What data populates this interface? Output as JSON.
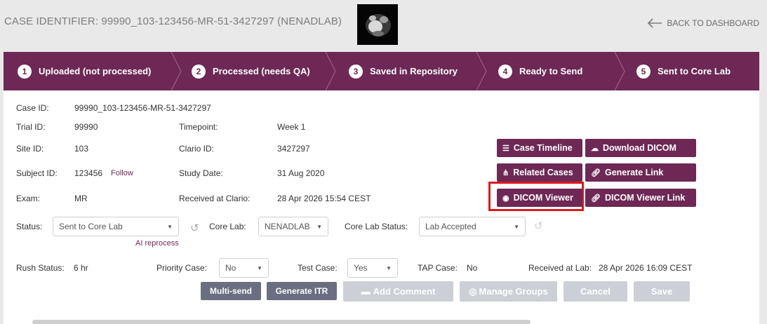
{
  "header": {
    "case_identifier": "CASE IDENTIFIER: 99990_103-123456-MR-51-3427297 (NENADLAB)",
    "back_label": "BACK TO DASHBOARD"
  },
  "steps": [
    {
      "num": "1",
      "label": "Uploaded (not processed)"
    },
    {
      "num": "2",
      "label": "Processed (needs QA)"
    },
    {
      "num": "3",
      "label": "Saved in Repository"
    },
    {
      "num": "4",
      "label": "Ready to Send"
    },
    {
      "num": "5",
      "label": "Sent to Core Lab"
    }
  ],
  "details": {
    "case_id_label": "Case ID:",
    "case_id": "99990_103-123456-MR-51-3427297",
    "trial_id_label": "Trial ID:",
    "trial_id": "99990",
    "timepoint_label": "Timepoint:",
    "timepoint": "Week 1",
    "site_id_label": "Site ID:",
    "site_id": "103",
    "clario_id_label": "Clario ID:",
    "clario_id": "3427297",
    "subject_id_label": "Subject ID:",
    "subject_id": "123456",
    "follow": "Follow",
    "study_date_label": "Study Date:",
    "study_date": "31 Aug 2020",
    "exam_label": "Exam:",
    "exam": "MR",
    "received_label": "Received at Clario:",
    "received": "28 Apr 2026 15:54 CEST"
  },
  "actions": {
    "case_timeline": "Case Timeline",
    "download_dicom": "Download DICOM",
    "related_cases": "Related Cases",
    "generate_link": "Generate Link",
    "dicom_viewer": "DICOM Viewer",
    "dicom_viewer_link": "DICOM Viewer Link"
  },
  "status_row": {
    "status_label": "Status:",
    "status_value": "Sent to Core Lab",
    "ai_reprocess": "AI reprocess",
    "core_lab_label": "Core Lab:",
    "core_lab_value": "NENADLAB",
    "core_lab_status_label": "Core Lab Status:",
    "core_lab_status_value": "Lab Accepted"
  },
  "rush_row": {
    "rush_label": "Rush Status:",
    "rush_value": "6 hr",
    "priority_label": "Priority Case:",
    "priority_value": "No",
    "test_label": "Test Case:",
    "test_value": "Yes",
    "tap_label": "TAP Case:",
    "tap_value": "No",
    "received_lab_label": "Received at Lab:",
    "received_lab_value": "28 Apr 2026 16:09 CEST"
  },
  "footer_buttons": {
    "multi_send": "Multi-send",
    "generate_itr": "Generate ITR",
    "add_comment": "Add Comment",
    "manage_groups": "Manage Groups",
    "cancel": "Cancel",
    "save": "Save"
  },
  "colors": {
    "brand": "#6d2855",
    "highlight": "#e0191b"
  }
}
